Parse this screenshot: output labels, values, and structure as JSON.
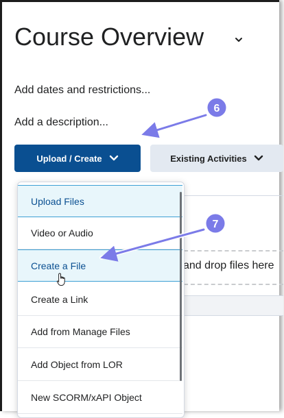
{
  "page": {
    "title": "Course Overview",
    "dates_link": "Add dates and restrictions...",
    "description_link": "Add a description..."
  },
  "toolbar": {
    "upload_create_label": "Upload / Create",
    "existing_activities_label": "Existing Activities"
  },
  "dropzone": {
    "text": "and drop files here"
  },
  "menu": {
    "items": [
      {
        "label": "Upload Files"
      },
      {
        "label": "Video or Audio"
      },
      {
        "label": "Create a File"
      },
      {
        "label": "Create a Link"
      },
      {
        "label": "Add from Manage Files"
      },
      {
        "label": "Add Object from LOR"
      },
      {
        "label": "New SCORM/xAPI Object"
      }
    ]
  },
  "annotations": {
    "step_6": "6",
    "step_7": "7"
  },
  "colors": {
    "primary_button": "#0a4f91",
    "secondary_button": "#e3e9f1",
    "menu_highlight": "#e8f6fb",
    "callout": "#7b7be8"
  }
}
